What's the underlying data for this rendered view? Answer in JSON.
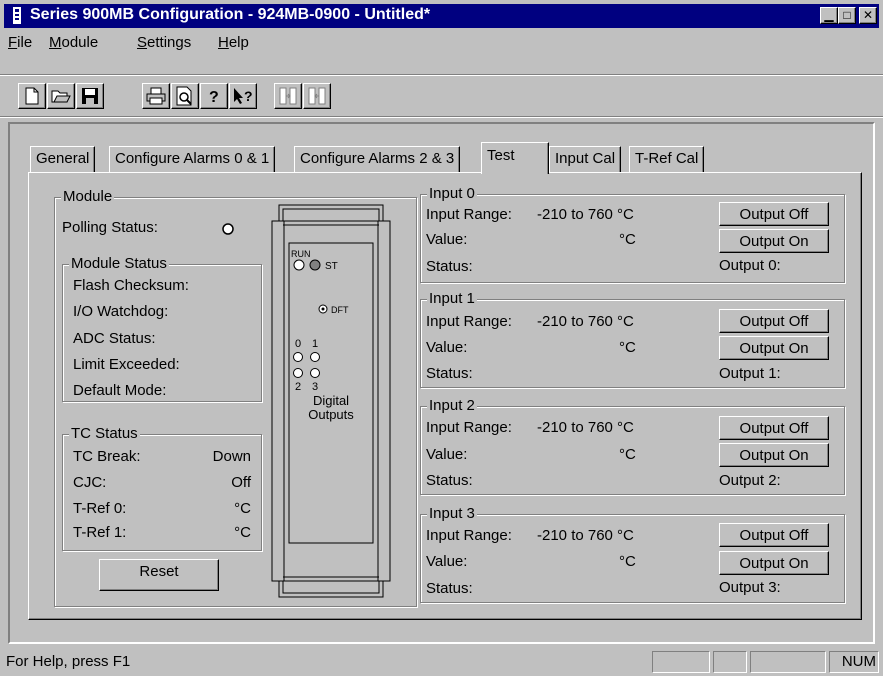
{
  "window": {
    "title": "Series 900MB Configuration - 924MB-0900 - Untitled*"
  },
  "menu": {
    "items": [
      {
        "label": "File",
        "accel": "F",
        "rest": "ile"
      },
      {
        "label": "Module",
        "accel": "M",
        "rest": "odule"
      },
      {
        "label": "Settings",
        "accel": "S",
        "rest": "ettings"
      },
      {
        "label": "Help",
        "accel": "H",
        "rest": "elp"
      }
    ]
  },
  "toolbar": {
    "buttons": [
      "new-file-icon",
      "open-folder-icon",
      "save-disk-icon",
      "print-icon",
      "print-preview-icon",
      "about-icon",
      "context-help-icon",
      "upload-icon",
      "download-icon"
    ]
  },
  "tabs": [
    "General",
    "Configure Alarms 0 & 1",
    "Configure Alarms 2 & 3",
    "Test",
    "Input Cal",
    "T-Ref Cal"
  ],
  "module": {
    "group_label": "Module",
    "polling_status_label": "Polling Status:",
    "module_status": {
      "label": "Module Status",
      "items": [
        "Flash Checksum:",
        "I/O Watchdog:",
        "ADC Status:",
        "Limit Exceeded:",
        "Default Mode:"
      ]
    },
    "tc_status": {
      "label": "TC Status",
      "rows": [
        {
          "label": "TC Break:",
          "value": "Down"
        },
        {
          "label": "CJC:",
          "value": "Off"
        },
        {
          "label": "T-Ref 0:",
          "value": "°C"
        },
        {
          "label": "T-Ref 1:",
          "value": "°C"
        }
      ]
    },
    "reset_button": "Reset",
    "diagram": {
      "run": "RUN",
      "st": "ST",
      "dft": "DFT",
      "ch0": "0",
      "ch1": "1",
      "ch2": "2",
      "ch3": "3",
      "digital": "Digital",
      "outputs": "Outputs"
    }
  },
  "inputs": [
    {
      "label": "Input 0",
      "range_label": "Input Range:",
      "range": "-210 to 760 °C",
      "value_label": "Value:",
      "unit": "°C",
      "status_label": "Status:",
      "off_button": "Output Off",
      "on_button": "Output On",
      "output_label": "Output 0:"
    },
    {
      "label": "Input 1",
      "range_label": "Input Range:",
      "range": "-210 to 760 °C",
      "value_label": "Value:",
      "unit": "°C",
      "status_label": "Status:",
      "off_button": "Output Off",
      "on_button": "Output On",
      "output_label": "Output 1:"
    },
    {
      "label": "Input 2",
      "range_label": "Input Range:",
      "range": "-210 to 760 °C",
      "value_label": "Value:",
      "unit": "°C",
      "status_label": "Status:",
      "off_button": "Output Off",
      "on_button": "Output On",
      "output_label": "Output 2:"
    },
    {
      "label": "Input 3",
      "range_label": "Input Range:",
      "range": "-210 to 760 °C",
      "value_label": "Value:",
      "unit": "°C",
      "status_label": "Status:",
      "off_button": "Output Off",
      "on_button": "Output On",
      "output_label": "Output 3:"
    }
  ],
  "status_bar": {
    "help_text": "For Help, press F1",
    "num": "NUM"
  }
}
